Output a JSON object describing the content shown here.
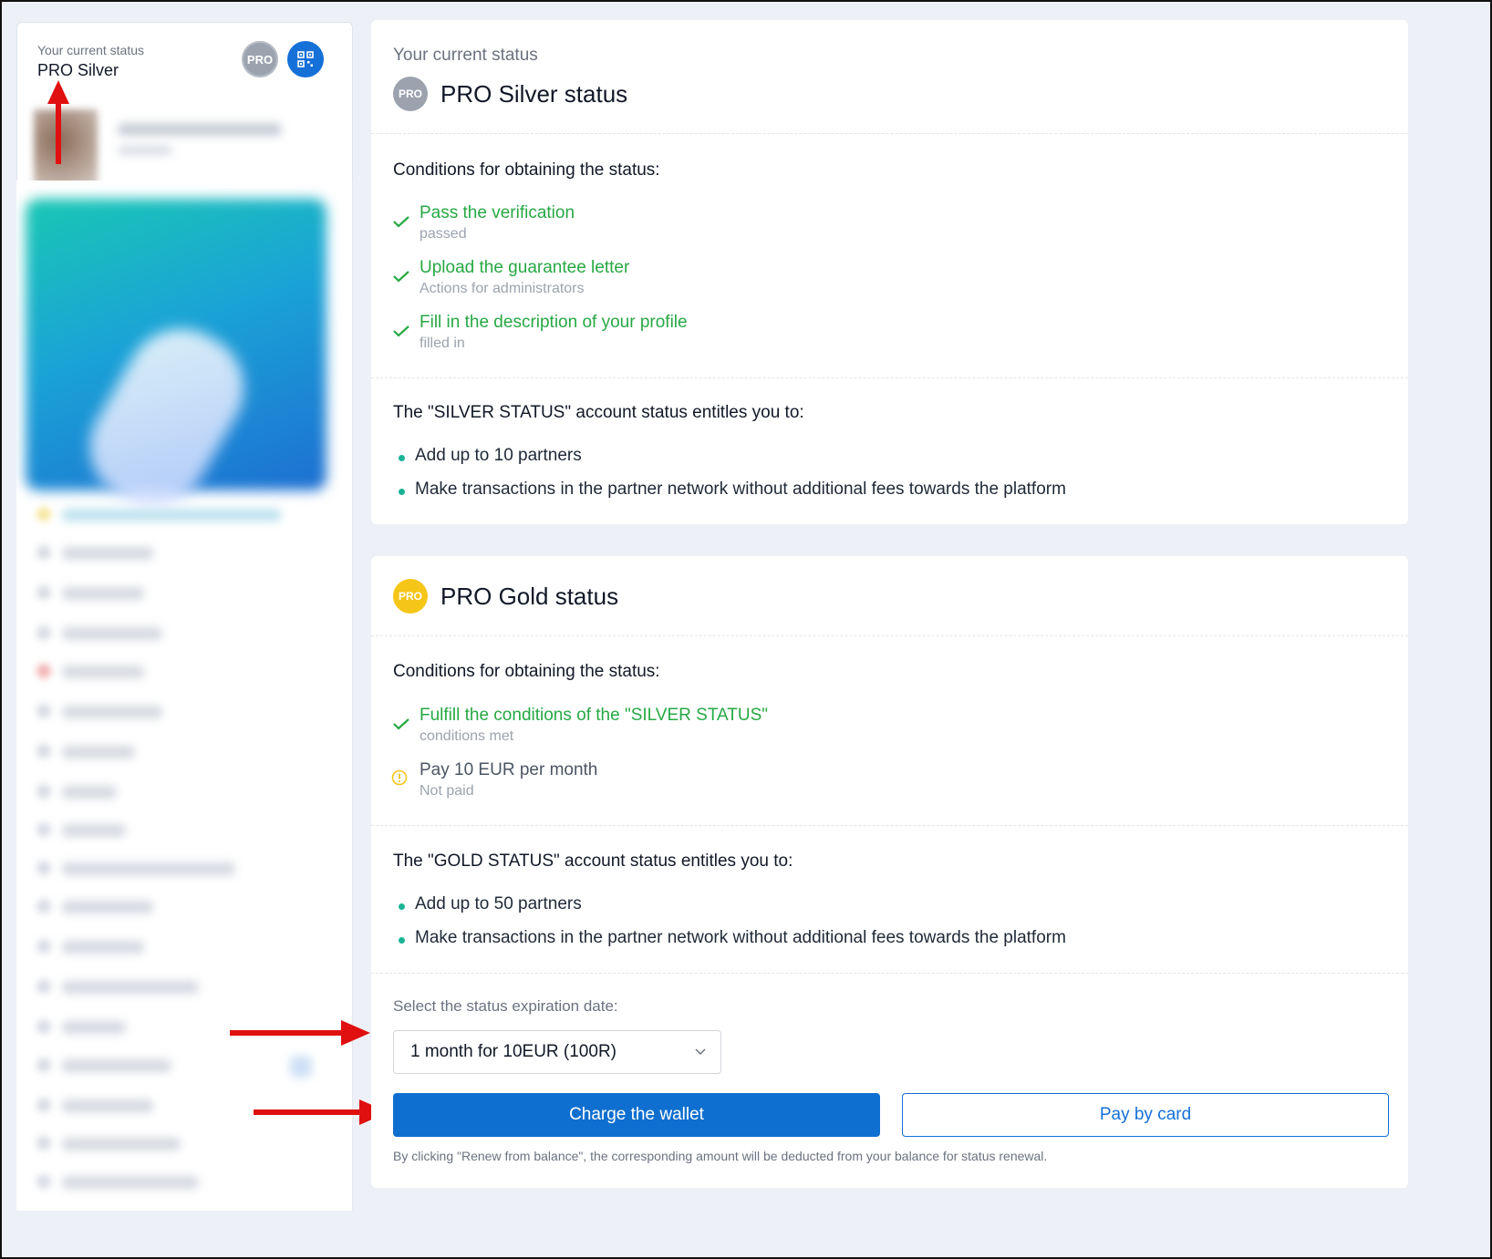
{
  "sidebar": {
    "status_label": "Your current status",
    "status_value": "PRO Silver",
    "pro_badge": "PRO",
    "qr_icon": "qr-code-icon"
  },
  "silver": {
    "current_label": "Your current status",
    "badge": "PRO",
    "title": "PRO Silver status",
    "conditions_heading": "Conditions for obtaining the status:",
    "conditions": [
      {
        "title": "Pass the verification",
        "sub": "passed"
      },
      {
        "title": "Upload the guarantee letter",
        "sub": "Actions for administrators"
      },
      {
        "title": "Fill in the description of your profile",
        "sub": "filled in"
      }
    ],
    "entitles_heading": "The \"SILVER STATUS\" account status entitles you to:",
    "benefits": [
      "Add up to 10 partners",
      "Make transactions in the partner network without additional fees towards the platform"
    ]
  },
  "gold": {
    "badge": "PRO",
    "title": "PRO Gold status",
    "conditions_heading": "Conditions for obtaining the status:",
    "conditions": [
      {
        "title": "Fulfill the conditions of the \"SILVER STATUS\"",
        "sub": "conditions met",
        "state": "done"
      },
      {
        "title": "Pay 10 EUR per month",
        "sub": "Not paid",
        "state": "warning"
      }
    ],
    "entitles_heading": "The \"GOLD STATUS\" account status entitles you to:",
    "benefits": [
      "Add up to 50 partners",
      "Make transactions in the partner network without additional fees towards the platform"
    ],
    "expiration_label": "Select the status expiration date:",
    "expiration_value": "1 month for 10EUR (100R)",
    "charge_button": "Charge the wallet",
    "card_button": "Pay by card",
    "footnote": "By clicking \"Renew from balance\", the corresponding amount will be deducted from your balance for status renewal."
  },
  "colors": {
    "accent": "#0f6fd0",
    "success": "#27a844",
    "warning": "#f5c518",
    "silver": "#9ca3af",
    "gold": "#f5c518",
    "annotation_arrow": "#e01010"
  }
}
